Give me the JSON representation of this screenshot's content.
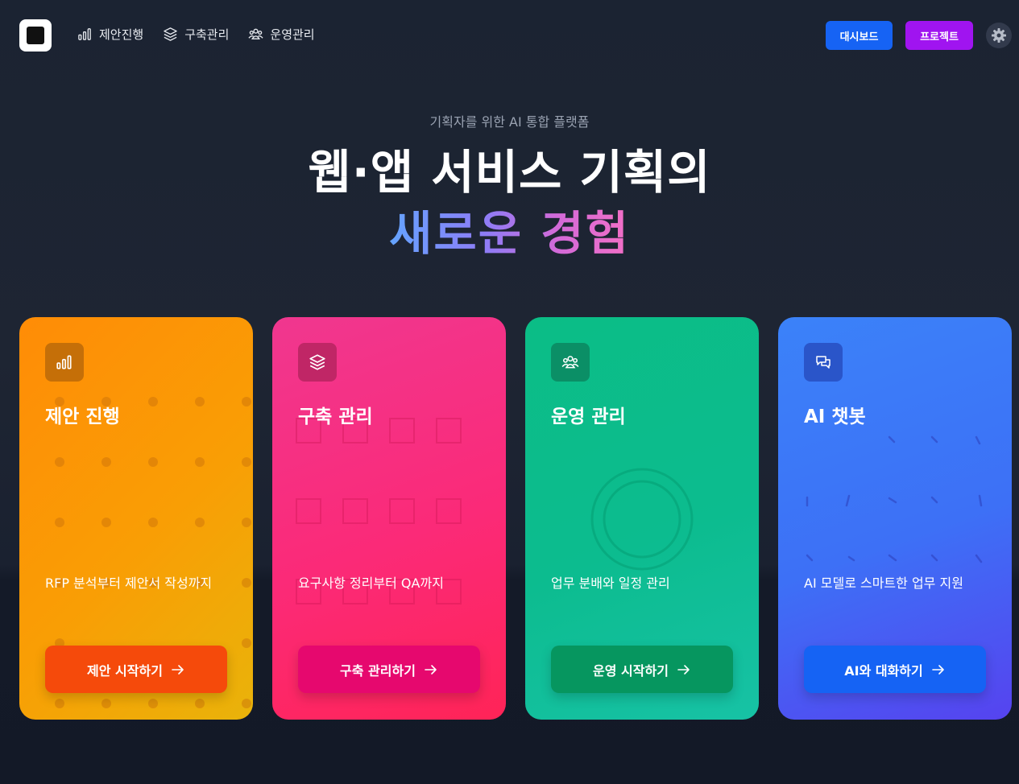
{
  "header": {
    "nav": [
      {
        "label": "제안진행",
        "icon": "bar-chart-icon"
      },
      {
        "label": "구축관리",
        "icon": "layers-icon"
      },
      {
        "label": "운영관리",
        "icon": "users-icon"
      }
    ],
    "dashboard_label": "대시보드",
    "project_label": "프로젝트",
    "colors": {
      "dashboard": "#1663f4",
      "project": "#a014f0"
    }
  },
  "hero": {
    "eyebrow": "기획자를 위한 AI 통합 플랫폼",
    "line1": "웹·앱 서비스 기획의",
    "line2": "새로운 경험"
  },
  "cards": [
    {
      "title": "제안 진행",
      "description": "RFP 분석부터 제안서 작성까지",
      "button": "제안 시작하기",
      "icon": "bar-chart-icon",
      "color": "#ff8c06"
    },
    {
      "title": "구축 관리",
      "description": "요구사항 정리부터 QA까지",
      "button": "구축 관리하기",
      "icon": "layers-icon",
      "color": "#fb2a78"
    },
    {
      "title": "운영 관리",
      "description": "업무 분배와 일정 관리",
      "button": "운영 시작하기",
      "icon": "users-icon",
      "color": "#0cbc8f"
    },
    {
      "title": "AI 챗봇",
      "description": "AI 모델로 스마트한 업무 지원",
      "button": "AI와 대화하기",
      "icon": "chat-icon",
      "color": "#3d70f6"
    }
  ]
}
